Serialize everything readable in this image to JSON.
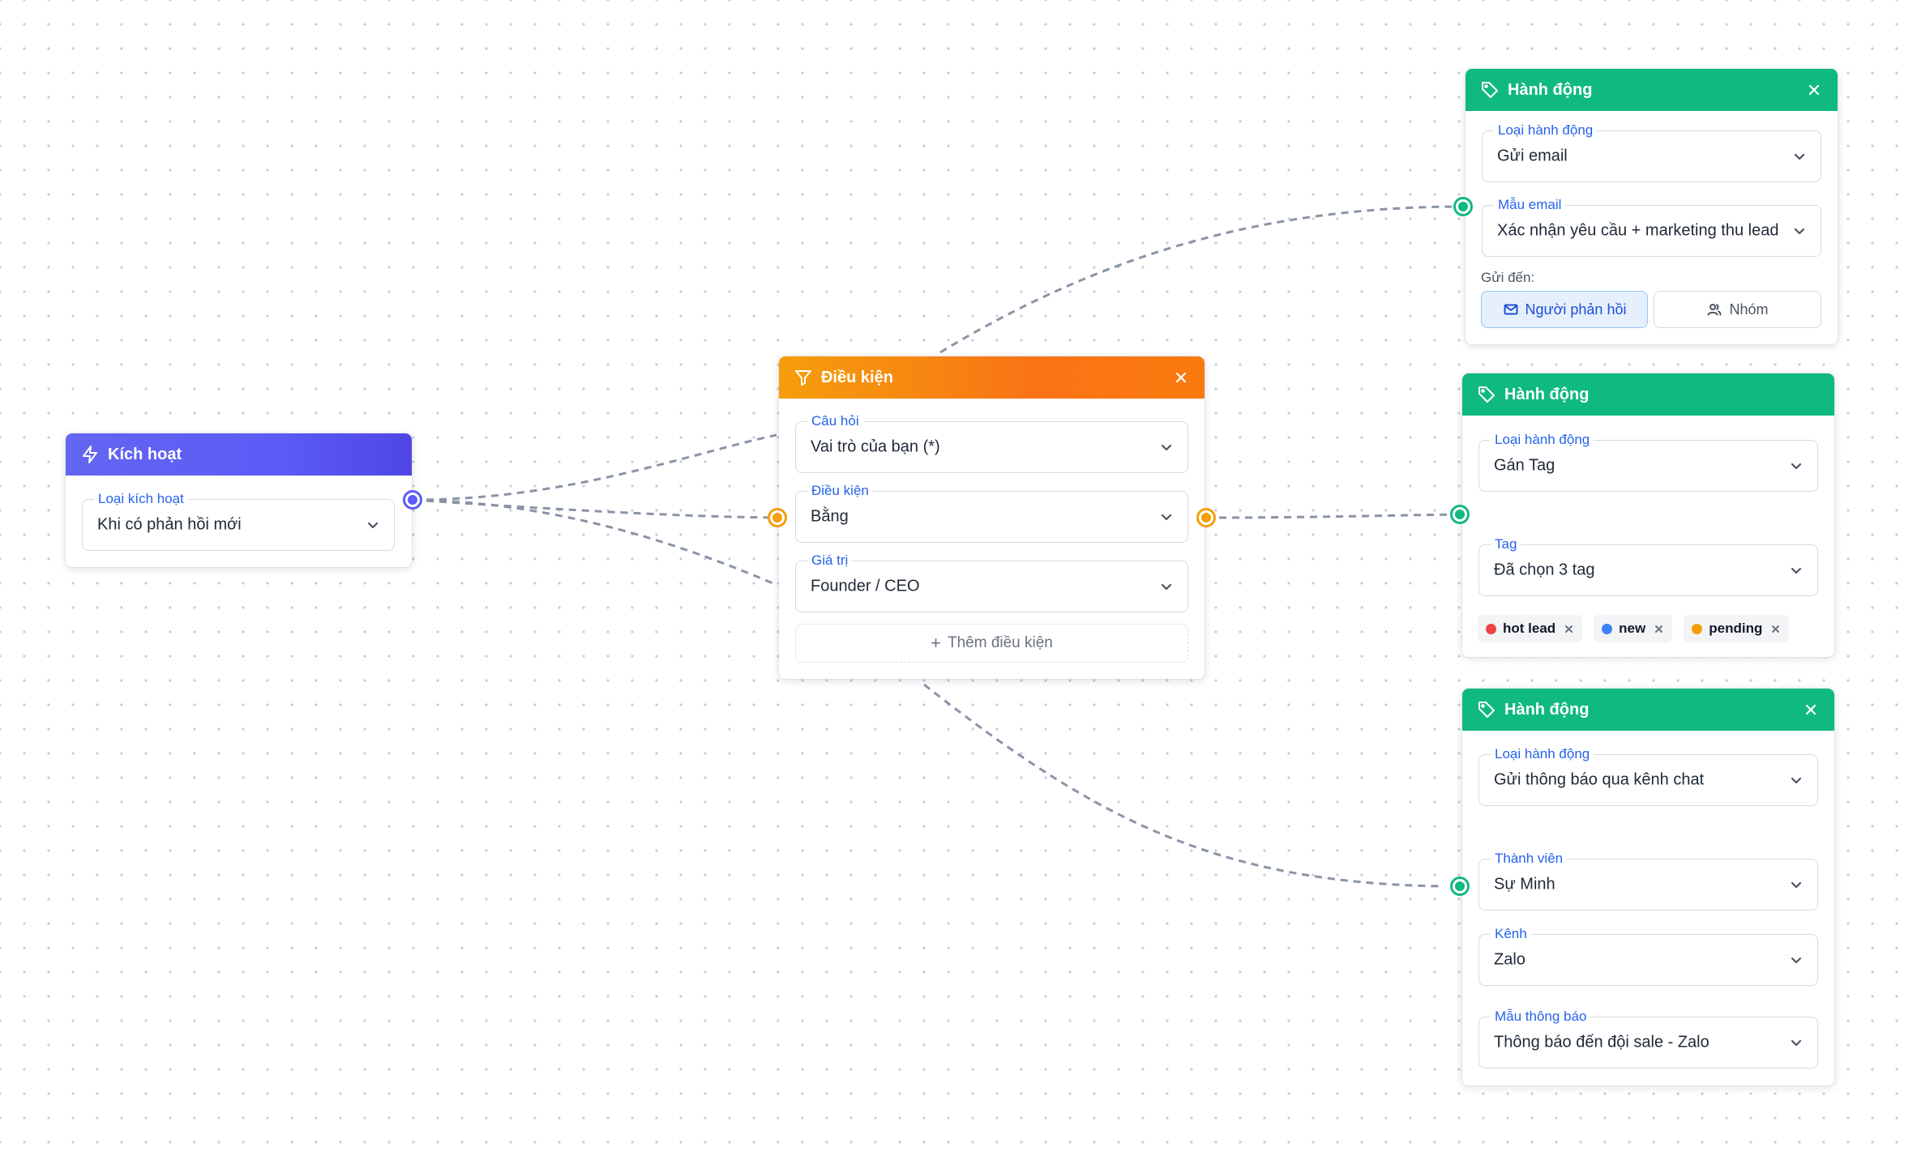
{
  "trigger_node": {
    "title": "Kích hoạt",
    "icon": "lightning-icon",
    "accent": "#5b5cf6",
    "trigger_type": {
      "label": "Loại kích hoạt",
      "value": "Khi có phản hồi mới"
    }
  },
  "condition_node": {
    "title": "Điều kiện",
    "icon": "filter-icon",
    "accent": "#f97316",
    "question": {
      "label": "Câu hỏi",
      "value": "Vai trò của bạn (*)"
    },
    "operator": {
      "label": "Điều kiện",
      "value": "Bằng"
    },
    "value": {
      "label": "Giá trị",
      "value": "Founder / CEO"
    },
    "add_condition": "Thêm điều kiện"
  },
  "action_email": {
    "title": "Hành động",
    "icon": "tag-icon",
    "accent": "#10b981",
    "action_type": {
      "label": "Loại hành động",
      "value": "Gửi email"
    },
    "template": {
      "label": "Mẫu email",
      "value": "Xác nhận yêu cầu + marketing thu lead"
    },
    "send_to_label": "Gửi đến:",
    "recipient_options": [
      {
        "label": "Người phản hồi",
        "icon": "mail-icon",
        "selected": true
      },
      {
        "label": "Nhóm",
        "icon": "users-icon",
        "selected": false
      }
    ]
  },
  "action_tag": {
    "title": "Hành động",
    "icon": "tag-icon",
    "accent": "#10b981",
    "action_type": {
      "label": "Loại hành động",
      "value": "Gán Tag"
    },
    "tag": {
      "label": "Tag",
      "value": "Đã chọn 3 tag"
    },
    "selected_tags": [
      {
        "name": "hot lead",
        "color": "#ef4444"
      },
      {
        "name": "new",
        "color": "#3b82f6"
      },
      {
        "name": "pending",
        "color": "#f59e0b"
      }
    ]
  },
  "action_chat": {
    "title": "Hành động",
    "icon": "tag-icon",
    "accent": "#10b981",
    "action_type": {
      "label": "Loại hành động",
      "value": "Gửi thông báo qua kênh chat"
    },
    "member": {
      "label": "Thành viên",
      "value": "Sự Minh"
    },
    "channel": {
      "label": "Kênh",
      "value": "Zalo"
    },
    "template": {
      "label": "Mẫu thông báo",
      "value": "Thông báo đến đội sale - Zalo"
    }
  }
}
